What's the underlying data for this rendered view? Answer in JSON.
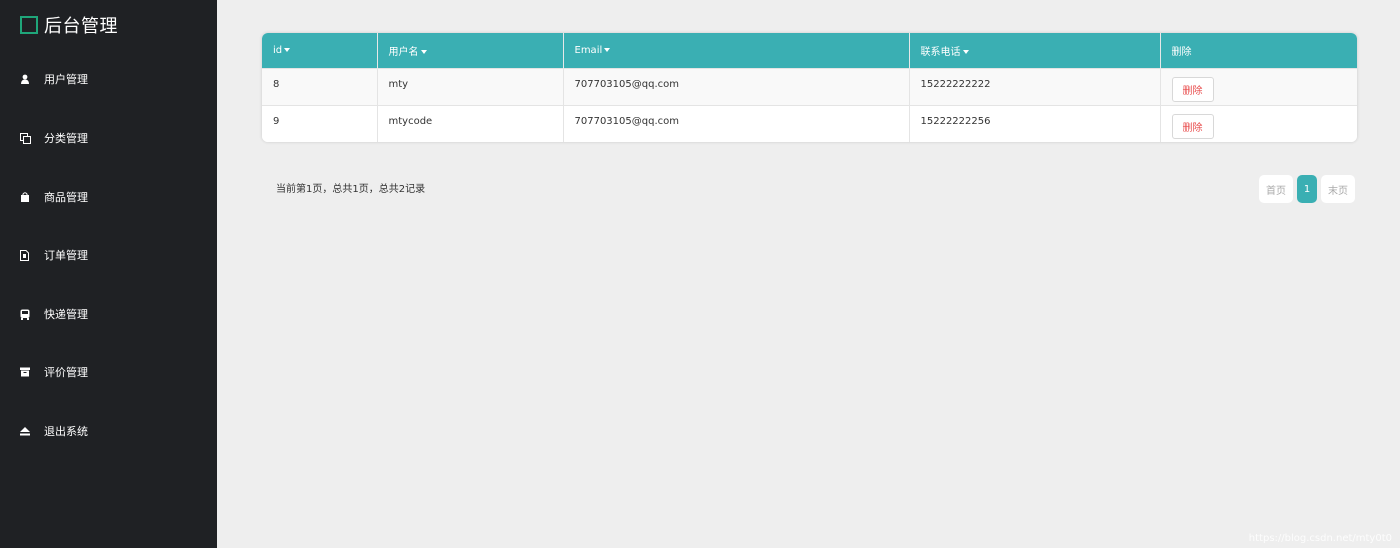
{
  "sidebar": {
    "brand": "后台管理",
    "items": [
      {
        "label": "用户管理",
        "icon": "user-icon"
      },
      {
        "label": "分类管理",
        "icon": "copy-icon"
      },
      {
        "label": "商品管理",
        "icon": "shopping-bag-icon"
      },
      {
        "label": "订单管理",
        "icon": "file-icon"
      },
      {
        "label": "快递管理",
        "icon": "bus-icon"
      },
      {
        "label": "评价管理",
        "icon": "archive-icon"
      },
      {
        "label": "退出系统",
        "icon": "eject-icon"
      }
    ]
  },
  "table": {
    "columns": [
      "id",
      "用户名",
      "Email",
      "联系电话",
      "删除"
    ],
    "rows": [
      {
        "id": "8",
        "username": "mty",
        "email": "707703105@qq.com",
        "phone": "15222222222",
        "action": "删除"
      },
      {
        "id": "9",
        "username": "mtycode",
        "email": "707703105@qq.com",
        "phone": "15222222256",
        "action": "删除"
      }
    ]
  },
  "pagination": {
    "info": "当前第1页，总共1页，总共2记录",
    "first": "首页",
    "current": "1",
    "last": "末页"
  },
  "watermark": "https://blog.csdn.net/mty0t0",
  "colors": {
    "accent": "#3aafb3",
    "sidebar_bg": "#1f2124",
    "brand_green": "#1fa67a",
    "delete_red": "#e84b4b"
  }
}
